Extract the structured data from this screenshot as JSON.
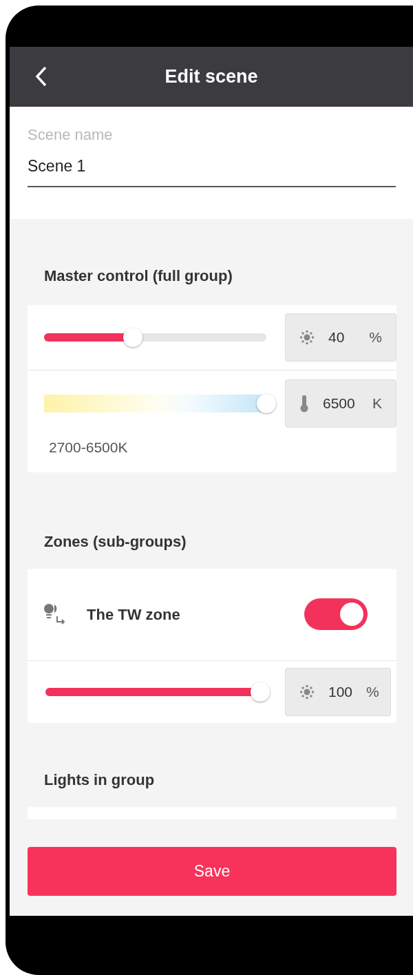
{
  "header": {
    "title": "Edit scene"
  },
  "scene_name": {
    "label": "Scene name",
    "value": "Scene 1"
  },
  "master": {
    "heading": "Master control (full group)",
    "brightness": {
      "level": 0.4,
      "value": "40",
      "unit": "%"
    },
    "color_temp": {
      "level": 1,
      "value": "6500",
      "unit": "K",
      "range": "2700-6500K"
    }
  },
  "zones": {
    "heading": "Zones (sub-groups)",
    "items": [
      {
        "name": "The TW zone",
        "on": true,
        "brightness": {
          "level": 1,
          "value": "100",
          "unit": "%"
        }
      }
    ]
  },
  "lights": {
    "heading": "Lights in group"
  },
  "save": "Save"
}
